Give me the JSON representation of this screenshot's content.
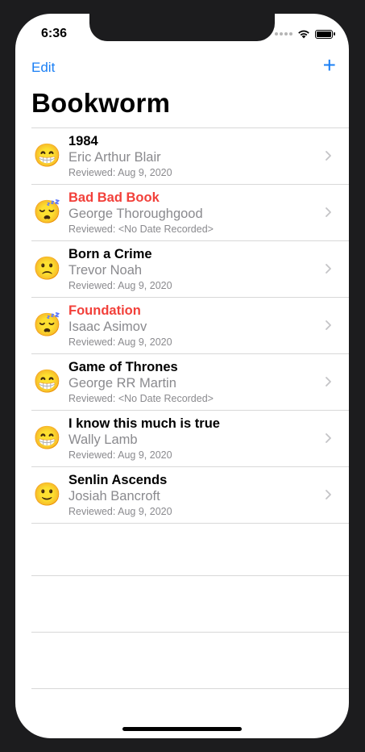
{
  "status": {
    "time": "6:36"
  },
  "nav": {
    "edit_label": "Edit",
    "add_label": "+",
    "title": "Bookworm"
  },
  "colors": {
    "accent": "#1a7ff5",
    "bad_rating": "#f2403a"
  },
  "books": [
    {
      "emoji": "😁",
      "rating_icon": "grinning-face-icon",
      "title": "1984",
      "author": "Eric Arthur Blair",
      "reviewed": "Reviewed: Aug 9, 2020",
      "bad": false
    },
    {
      "emoji": "😴",
      "rating_icon": "sleeping-face-icon",
      "title": "Bad Bad Book",
      "author": "George Thoroughgood",
      "reviewed": "Reviewed: <No Date Recorded>",
      "bad": true
    },
    {
      "emoji": "🙁",
      "rating_icon": "frowning-face-icon",
      "title": "Born a Crime",
      "author": "Trevor Noah",
      "reviewed": "Reviewed: Aug 9, 2020",
      "bad": false
    },
    {
      "emoji": "😴",
      "rating_icon": "sleeping-face-icon",
      "title": "Foundation",
      "author": "Isaac Asimov",
      "reviewed": "Reviewed: Aug 9, 2020",
      "bad": true
    },
    {
      "emoji": "😁",
      "rating_icon": "grinning-face-icon",
      "title": "Game of Thrones",
      "author": "George RR Martin",
      "reviewed": "Reviewed: <No Date Recorded>",
      "bad": false
    },
    {
      "emoji": "😁",
      "rating_icon": "grinning-face-icon",
      "title": "I know this much is true",
      "author": "Wally Lamb",
      "reviewed": "Reviewed: Aug 9, 2020",
      "bad": false
    },
    {
      "emoji": "🙂",
      "rating_icon": "slightly-smiling-face-icon",
      "title": "Senlin Ascends",
      "author": "Josiah Bancroft",
      "reviewed": "Reviewed: Aug 9, 2020",
      "bad": false
    }
  ]
}
